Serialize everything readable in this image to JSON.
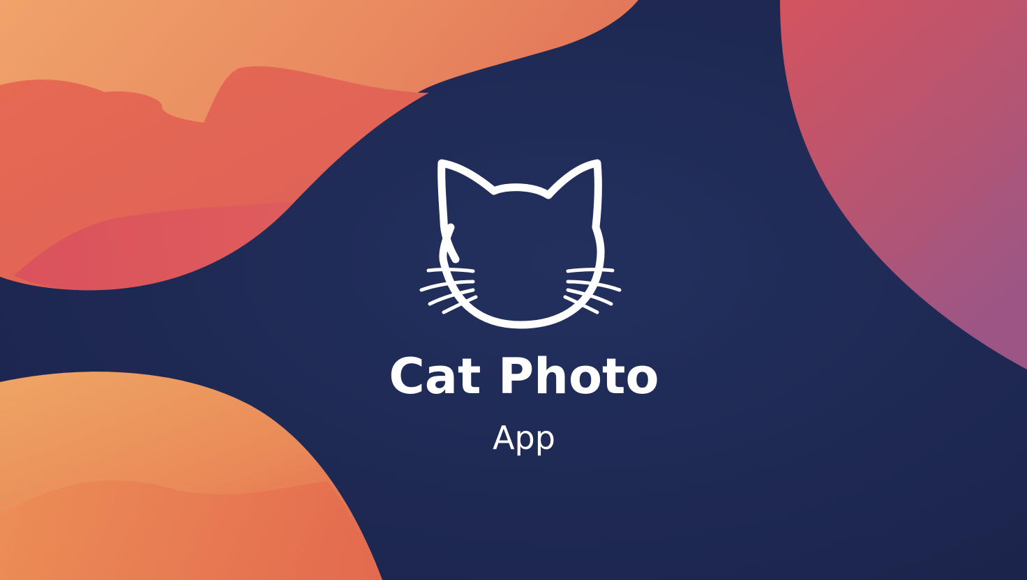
{
  "app": {
    "title": "Cat Photo",
    "subtitle": "App",
    "logo_icon": "cat-head-outline-icon"
  },
  "colors": {
    "background": "#1f2a52",
    "orange": "#e98e5e",
    "coral": "#e0645a",
    "pink": "#d9505e",
    "magenta": "#a3557f",
    "text": "#ffffff"
  }
}
